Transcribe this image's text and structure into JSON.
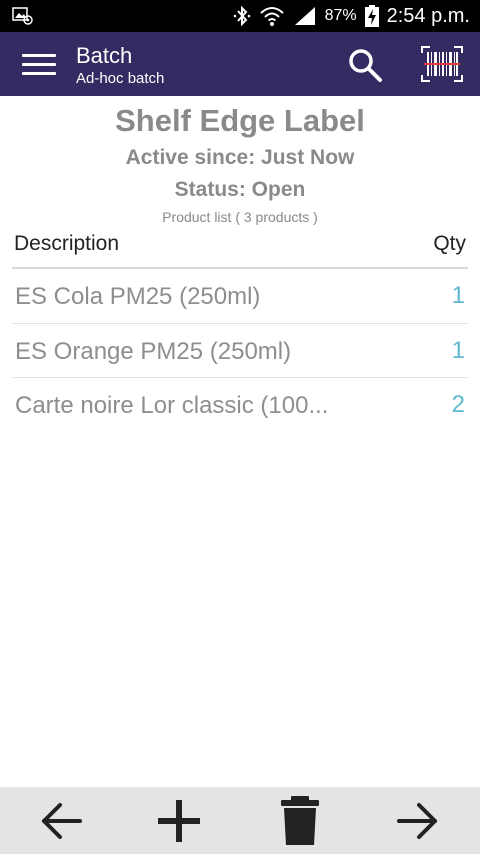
{
  "status_bar": {
    "battery_percent": "87%",
    "time": "2:54 p.m.",
    "icons": [
      "notification-icon",
      "bluetooth-icon",
      "wifi-icon",
      "signal-icon",
      "battery-charging-icon"
    ]
  },
  "app_bar": {
    "title": "Batch",
    "subtitle": "Ad-hoc batch",
    "background_color": "#322c63",
    "icons": [
      "menu-icon",
      "search-icon",
      "barcode-icon"
    ]
  },
  "batch": {
    "name": "Shelf Edge Label",
    "active_since": "Active since: Just Now",
    "status": "Status: Open",
    "product_count": "Product list ( 3 products )"
  },
  "table": {
    "headers": {
      "description": "Description",
      "qty": "Qty"
    },
    "rows": [
      {
        "description": "ES Cola PM25 (250ml)",
        "qty": "1"
      },
      {
        "description": "ES Orange PM25 (250ml)",
        "qty": "1"
      },
      {
        "description": "Carte noire Lor classic (100...",
        "qty": "2"
      }
    ],
    "qty_color": "#5fb8cf"
  },
  "bottom_bar": {
    "icons": [
      "arrow-back-icon",
      "add-icon",
      "delete-icon",
      "arrow-forward-icon"
    ]
  }
}
